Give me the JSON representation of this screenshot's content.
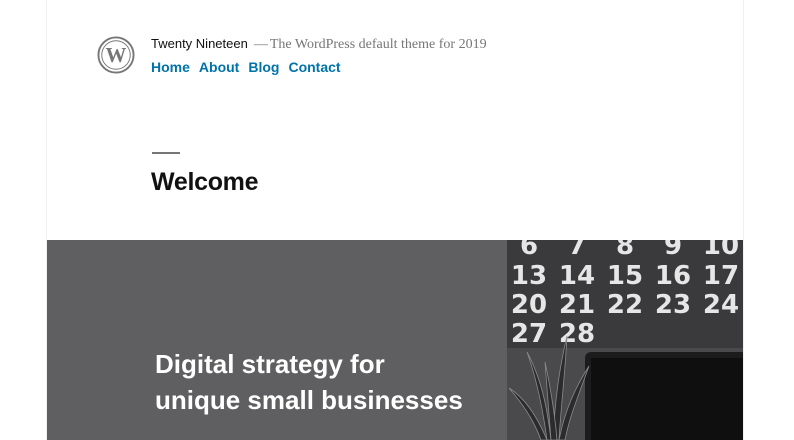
{
  "site": {
    "title": "Twenty Nineteen",
    "separator": "—",
    "description": "The WordPress default theme for 2019",
    "logo_icon": "wordpress-logo-icon"
  },
  "nav": {
    "items": [
      {
        "label": "Home"
      },
      {
        "label": "About"
      },
      {
        "label": "Blog"
      },
      {
        "label": "Contact"
      }
    ]
  },
  "page": {
    "title": "Welcome"
  },
  "hero": {
    "heading_line1": "Digital strategy for",
    "heading_line2": "unique small businesses",
    "background_color": "#5f5f61",
    "calendar_rows": [
      [
        "6",
        "7",
        "8",
        "9",
        "10"
      ],
      [
        "13",
        "14",
        "15",
        "16",
        "17"
      ],
      [
        "20",
        "21",
        "22",
        "23",
        "24"
      ],
      [
        "27",
        "28"
      ]
    ]
  },
  "colors": {
    "link": "#0073aa",
    "title_text": "#111111",
    "muted_text": "#767676"
  }
}
